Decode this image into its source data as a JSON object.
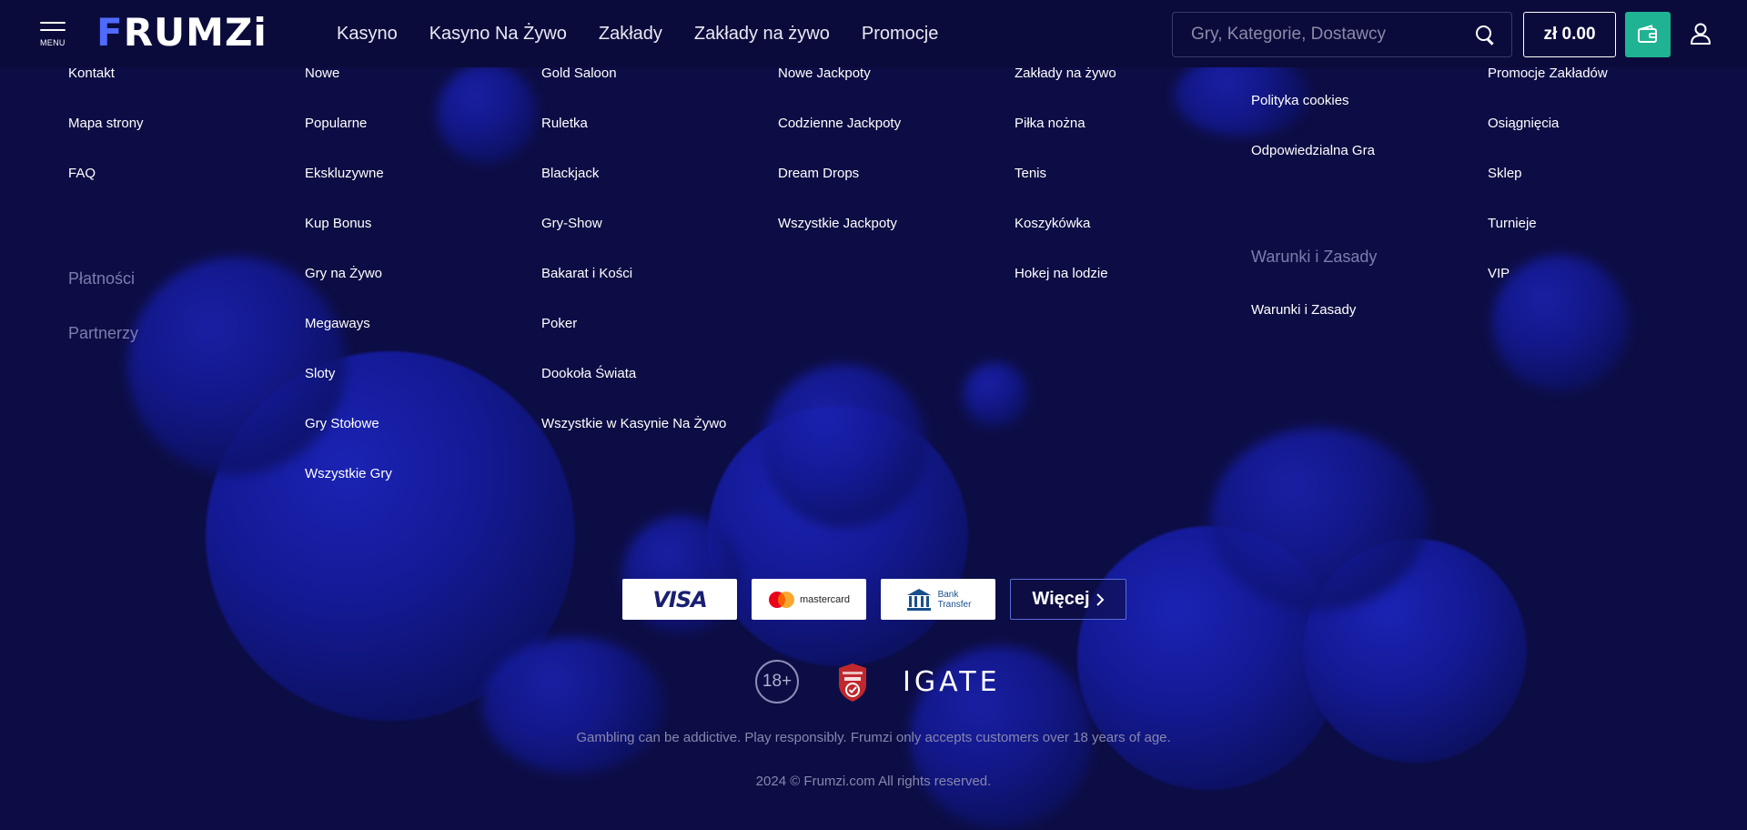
{
  "header": {
    "menu_label": "MENU",
    "logo_text": "FRUMZi",
    "nav": [
      "Kasyno",
      "Kasyno Na Żywo",
      "Zakłady",
      "Zakłady na żywo",
      "Promocje"
    ],
    "search_placeholder": "Gry, Kategorie, Dostawcy",
    "balance": "zł 0.00"
  },
  "footer": {
    "col1": {
      "links": [
        "Kontakt",
        "Mapa strony",
        "FAQ"
      ],
      "headings": [
        "Płatności",
        "Partnerzy"
      ]
    },
    "col2": {
      "links": [
        "Nowe",
        "Popularne",
        "Ekskluzywne",
        "Kup Bonus",
        "Gry na Żywo",
        "Megaways",
        "Sloty",
        "Gry Stołowe",
        "Wszystkie Gry"
      ]
    },
    "col3": {
      "links": [
        "Gold Saloon",
        "Ruletka",
        "Blackjack",
        "Gry-Show",
        "Bakarat i Kości",
        "Poker",
        "Dookoła Świata",
        "Wszystkie w Kasynie Na Żywo"
      ]
    },
    "col4": {
      "links": [
        "Nowe Jackpoty",
        "Codzienne Jackpoty",
        "Dream Drops",
        "Wszystkie Jackpoty"
      ]
    },
    "col5": {
      "links": [
        "Zakłady na żywo",
        "Piłka nożna",
        "Tenis",
        "Koszykówka",
        "Hokej na lodzie"
      ]
    },
    "col6": {
      "links": [
        "Polityka cookies",
        "Odpowiedzialna Gra"
      ],
      "heading": "Warunki i Zasady",
      "links2": [
        "Warunki i Zasady"
      ]
    },
    "col7": {
      "links": [
        "Promocje Zakładów",
        "Osiągnięcia",
        "Sklep",
        "Turnieje",
        "VIP"
      ]
    }
  },
  "payments": {
    "visa": "VISA",
    "mastercard": "mastercard",
    "bank_line1": "Bank",
    "bank_line2": "Transfer",
    "more": "Więcej"
  },
  "badges": {
    "age": "18+",
    "igate": "IGATE"
  },
  "disclaimer": "Gambling can be addictive. Play responsibly. Frumzi only accepts customers over 18 years of age.",
  "copyright": "2024 © Frumzi.com All rights reserved.",
  "colors": {
    "background": "#0d0d45",
    "header": "#0b0b3b",
    "accent_green": "#1fb393",
    "logo_blue": "#4f6bff",
    "heading_muted": "#7c7cae"
  }
}
